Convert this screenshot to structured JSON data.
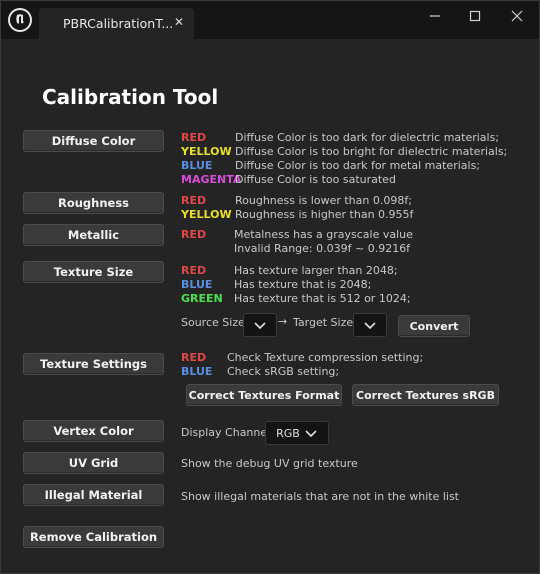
{
  "titlebar": {
    "tab_label": "PBRCalibrationT...",
    "tab_close": "✕"
  },
  "title": "Calibration Tool",
  "colors": {
    "red": "#e04848",
    "yellow": "#e8e028",
    "blue": "#5a8ee0",
    "magenta": "#d84cd8",
    "green": "#4ce04c"
  },
  "diffuse": {
    "button": "Diffuse Color",
    "rows": [
      {
        "key": "RED",
        "desc": "Diffuse Color is too dark for dielectric materials;"
      },
      {
        "key": "YELLOW",
        "desc": "Diffuse Color is too bright for dielectric materials;"
      },
      {
        "key": "BLUE",
        "desc": "Diffuse Color is too dark for metal materials;"
      },
      {
        "key": "MAGENTA",
        "desc": "Diffuse Color is too saturated"
      }
    ]
  },
  "roughness": {
    "button": "Roughness",
    "rows": [
      {
        "key": "RED",
        "desc": "Roughness is lower than 0.098f;"
      },
      {
        "key": "YELLOW",
        "desc": "Roughness is higher than 0.955f"
      }
    ]
  },
  "metallic": {
    "button": "Metallic",
    "key": "RED",
    "desc": "Metalness has a grayscale value",
    "desc2": "Invalid Range: 0.039f ~ 0.9216f"
  },
  "texture_size": {
    "button": "Texture Size",
    "rows": [
      {
        "key": "RED",
        "desc": "Has texture larger than 2048;"
      },
      {
        "key": "BLUE",
        "desc": "Has texture that is 2048;"
      },
      {
        "key": "GREEN",
        "desc": "Has texture that is 512 or 1024;"
      }
    ],
    "source_label": "Source Size",
    "arrow": "→",
    "target_label": "Target Size",
    "convert": "Convert"
  },
  "texture_settings": {
    "button": "Texture Settings",
    "rows": [
      {
        "key": "RED",
        "desc": "Check Texture compression setting;"
      },
      {
        "key": "BLUE",
        "desc": "Check sRGB setting;"
      }
    ],
    "correct_format": "Correct Textures Format",
    "correct_srgb": "Correct Textures sRGB"
  },
  "vertex_color": {
    "button": "Vertex Color",
    "label": "Display Channel:",
    "selected": "RGB"
  },
  "uv_grid": {
    "button": "UV Grid",
    "desc": "Show the debug UV grid texture"
  },
  "illegal": {
    "button": "Illegal Material",
    "desc": "Show illegal materials that are not in the white list"
  },
  "remove": {
    "button": "Remove Calibration"
  }
}
